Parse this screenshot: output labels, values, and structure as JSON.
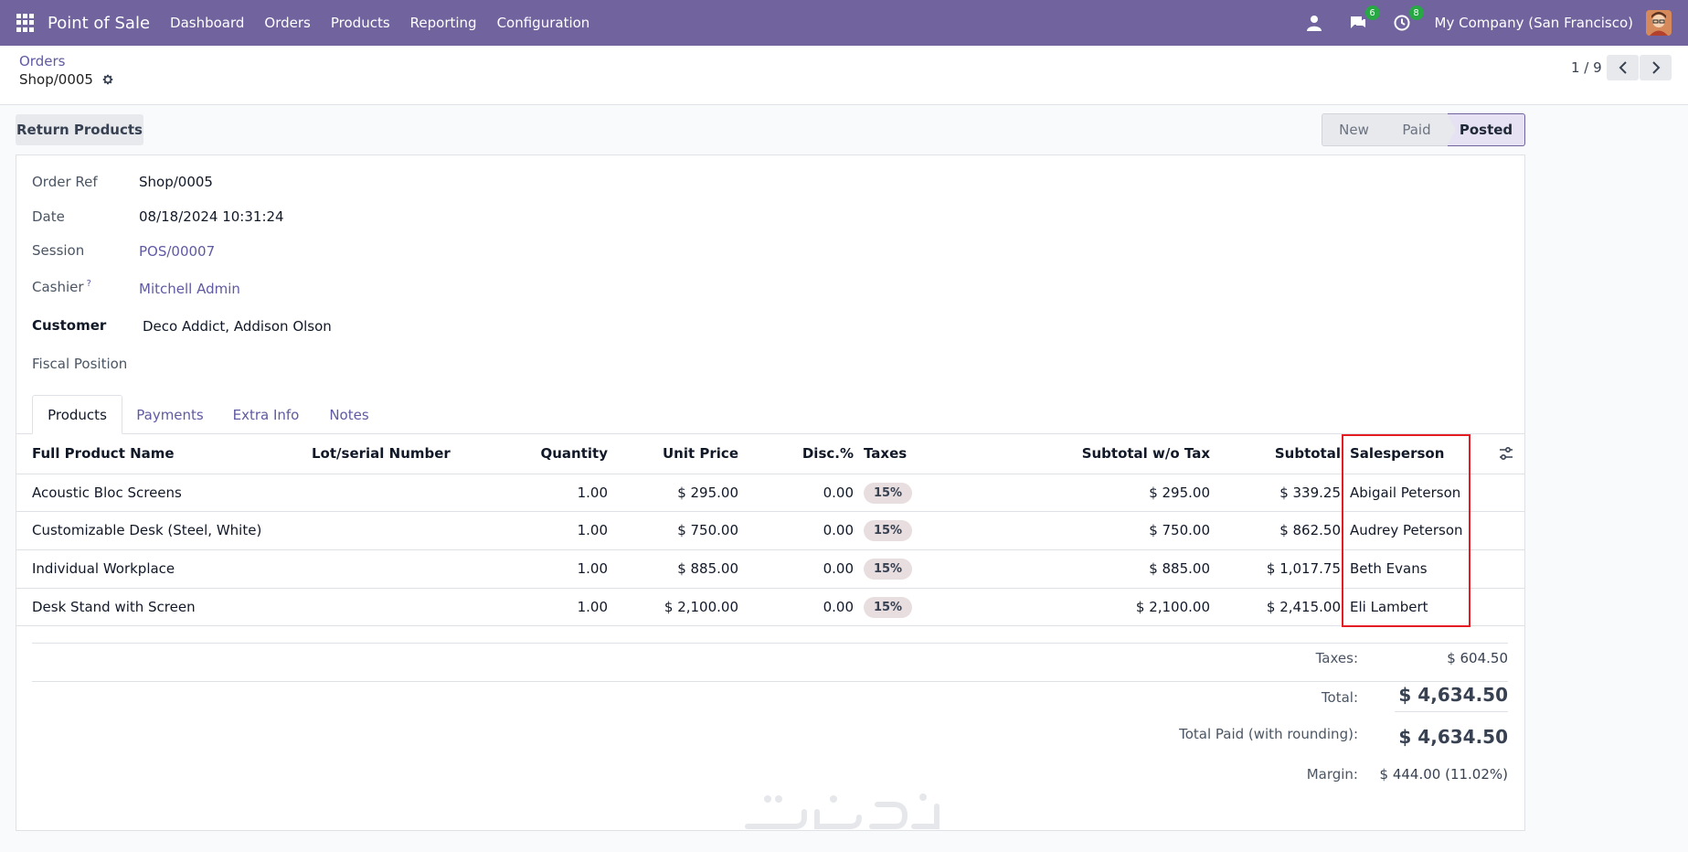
{
  "nav": {
    "brand": "Point of Sale",
    "menus": [
      "Dashboard",
      "Orders",
      "Products",
      "Reporting",
      "Configuration"
    ],
    "messages_badge": "6",
    "activities_badge": "8",
    "company": "My Company (San Francisco)"
  },
  "breadcrumb": {
    "parent": "Orders",
    "current": "Shop/0005"
  },
  "pager": {
    "value": "1 / 9"
  },
  "actions": {
    "return_products": "Return Products"
  },
  "status": {
    "stages": [
      "New",
      "Paid",
      "Posted"
    ],
    "active": "Posted"
  },
  "form": {
    "order_ref_label": "Order Ref",
    "order_ref": "Shop/0005",
    "date_label": "Date",
    "date": "08/18/2024 10:31:24",
    "session_label": "Session",
    "session": "POS/00007",
    "cashier_label": "Cashier",
    "cashier_help": "?",
    "cashier": "Mitchell Admin",
    "customer_label": "Customer",
    "customer": "Deco Addict, Addison Olson",
    "fiscal_label": "Fiscal Position"
  },
  "tabs": [
    "Products",
    "Payments",
    "Extra Info",
    "Notes"
  ],
  "table": {
    "headers": [
      "Full Product Name",
      "Lot/serial Number",
      "Quantity",
      "Unit Price",
      "Disc.%",
      "Taxes",
      "Subtotal w/o Tax",
      "Subtotal",
      "Salesperson"
    ],
    "rows": [
      {
        "name": "Acoustic Bloc Screens",
        "qty": "1.00",
        "unit_price": "$ 295.00",
        "disc": "0.00",
        "tax": "15%",
        "subtotal_wo": "$ 295.00",
        "subtotal": "$ 339.25",
        "salesperson": "Abigail Peterson"
      },
      {
        "name": "Customizable Desk (Steel, White)",
        "qty": "1.00",
        "unit_price": "$ 750.00",
        "disc": "0.00",
        "tax": "15%",
        "subtotal_wo": "$ 750.00",
        "subtotal": "$ 862.50",
        "salesperson": "Audrey Peterson"
      },
      {
        "name": "Individual Workplace",
        "qty": "1.00",
        "unit_price": "$ 885.00",
        "disc": "0.00",
        "tax": "15%",
        "subtotal_wo": "$ 885.00",
        "subtotal": "$ 1,017.75",
        "salesperson": "Beth Evans"
      },
      {
        "name": "Desk Stand with Screen",
        "qty": "1.00",
        "unit_price": "$ 2,100.00",
        "disc": "0.00",
        "tax": "15%",
        "subtotal_wo": "$ 2,100.00",
        "subtotal": "$ 2,415.00",
        "salesperson": "Eli Lambert"
      }
    ]
  },
  "totals": {
    "taxes_label": "Taxes:",
    "taxes": "$ 604.50",
    "total_label": "Total:",
    "total": "$ 4,634.50",
    "paid_label": "Total Paid (with rounding):",
    "paid": "$ 4,634.50",
    "margin_label": "Margin:",
    "margin": "$ 444.00 (11.02%)"
  },
  "colors": {
    "navbar": "#71639e",
    "link": "#5f5aa2",
    "highlight": "#e51c23",
    "badge": "#28a745"
  },
  "icons": [
    "apps-grid-icon",
    "user-icon",
    "chat-icon",
    "clock-icon",
    "gear-icon",
    "chevron-left-icon",
    "chevron-right-icon",
    "column-settings-icon"
  ]
}
